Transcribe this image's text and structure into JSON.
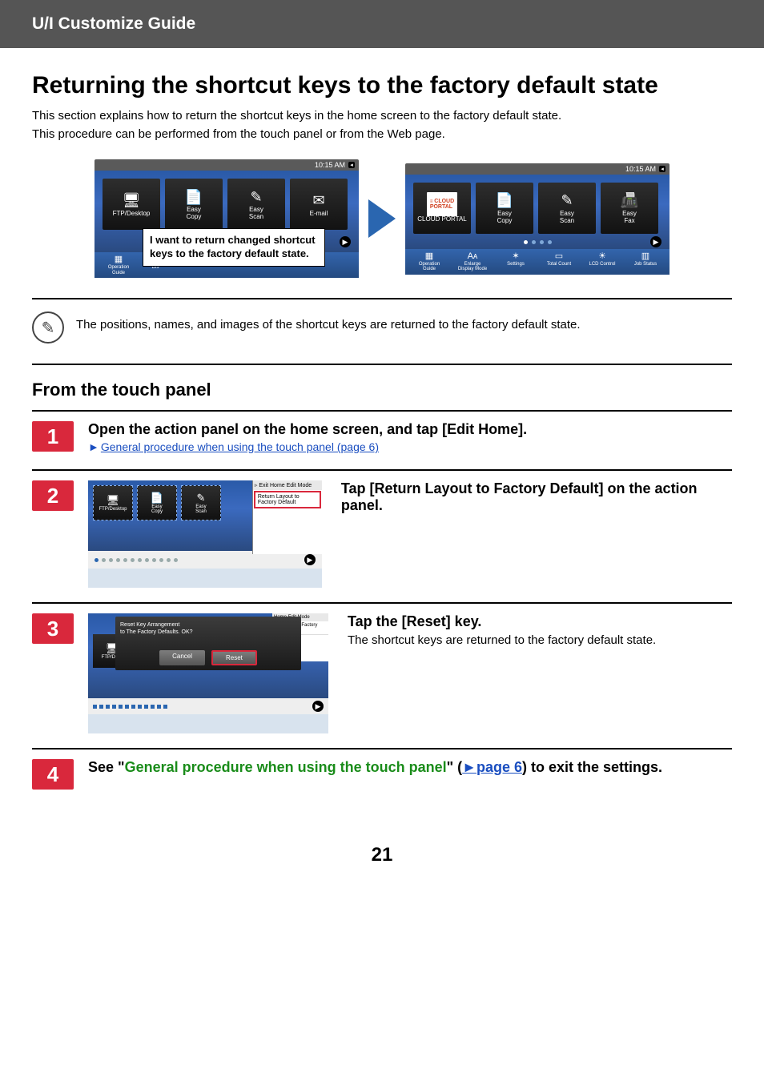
{
  "header": {
    "title": "U/I Customize Guide"
  },
  "page": {
    "title": "Returning the shortcut keys to the factory default state",
    "intro_line1": "This section explains how to return the shortcut keys in the home screen to the factory default state.",
    "intro_line2": "This procedure can be performed from the touch panel or from the Web page.",
    "page_number": "21"
  },
  "diagram": {
    "time": "10:15 AM",
    "left_keys": [
      {
        "label": "FTP/Desktop",
        "icon": "🖥",
        "cls": "ic-monitor"
      },
      {
        "label": "Easy\nCopy",
        "icon": "📄",
        "cls": "ic-copy"
      },
      {
        "label": "Easy\nScan",
        "icon": "✎",
        "cls": "ic-scan"
      },
      {
        "label": "E-mail",
        "icon": "✉",
        "cls": "ic-mail"
      }
    ],
    "left_bottom": [
      {
        "label": "Operation\nGuide",
        "icon": "▦"
      },
      {
        "label": "Dis",
        "icon": ""
      }
    ],
    "callout": "I want to return changed shortcut keys to the factory default state.",
    "right_keys": [
      {
        "label": "CLOUD PORTAL",
        "icon": "CLOUD",
        "cls": "ic-cloud-badge",
        "badge": true
      },
      {
        "label": "Easy\nCopy",
        "icon": "📄",
        "cls": "ic-copy"
      },
      {
        "label": "Easy\nScan",
        "icon": "✎",
        "cls": "ic-scan"
      },
      {
        "label": "Easy\nFax",
        "icon": "📠",
        "cls": "ic-fax"
      }
    ],
    "right_bottom": [
      {
        "label": "Operation\nGuide",
        "icon": "▦"
      },
      {
        "label": "Enlarge\nDisplay Mode",
        "icon": "Aᴀ"
      },
      {
        "label": "Settings",
        "icon": "✶"
      },
      {
        "label": "Total Count",
        "icon": "▭"
      },
      {
        "label": "LCD Control",
        "icon": "☀"
      },
      {
        "label": "Job Status",
        "icon": "▥"
      }
    ]
  },
  "note": "The positions, names, and images of the shortcut keys are returned to the factory default state.",
  "subhead": "From the touch panel",
  "steps": {
    "s1": {
      "num": "1",
      "title": "Open the action panel on the home screen, and tap [Edit Home].",
      "link": "General procedure when using the touch panel (page 6)"
    },
    "s2": {
      "num": "2",
      "title": "Tap [Return Layout to Factory Default] on the action panel.",
      "action_head": "Exit Home Edit Mode",
      "action_item": "Return Layout to Factory Default",
      "keys": [
        {
          "label": "FTP/Desktop",
          "icon": "🖥",
          "cls": "ic-monitor"
        },
        {
          "label": "Easy\nCopy",
          "icon": "📄",
          "cls": "ic-copy"
        },
        {
          "label": "Easy\nScan",
          "icon": "✎",
          "cls": "ic-scan"
        }
      ]
    },
    "s3": {
      "num": "3",
      "title": "Tap the [Reset] key.",
      "desc": "The shortcut keys are returned to the factory default state.",
      "dialog_l1": "Reset Key Arrangement",
      "dialog_l2": "to The Factory Defaults. OK?",
      "cancel": "Cancel",
      "reset": "Reset",
      "action_head_partial": "Home Edit Mode",
      "action_item_partial": "rn Layout to Factory\nult",
      "key_label": "FTP/Desk"
    },
    "s4": {
      "num": "4",
      "pre": "See \"",
      "green": "General procedure when using the touch panel",
      "mid": "\" (",
      "tri": "►",
      "page": "page 6",
      "post": ") to exit the settings."
    }
  }
}
